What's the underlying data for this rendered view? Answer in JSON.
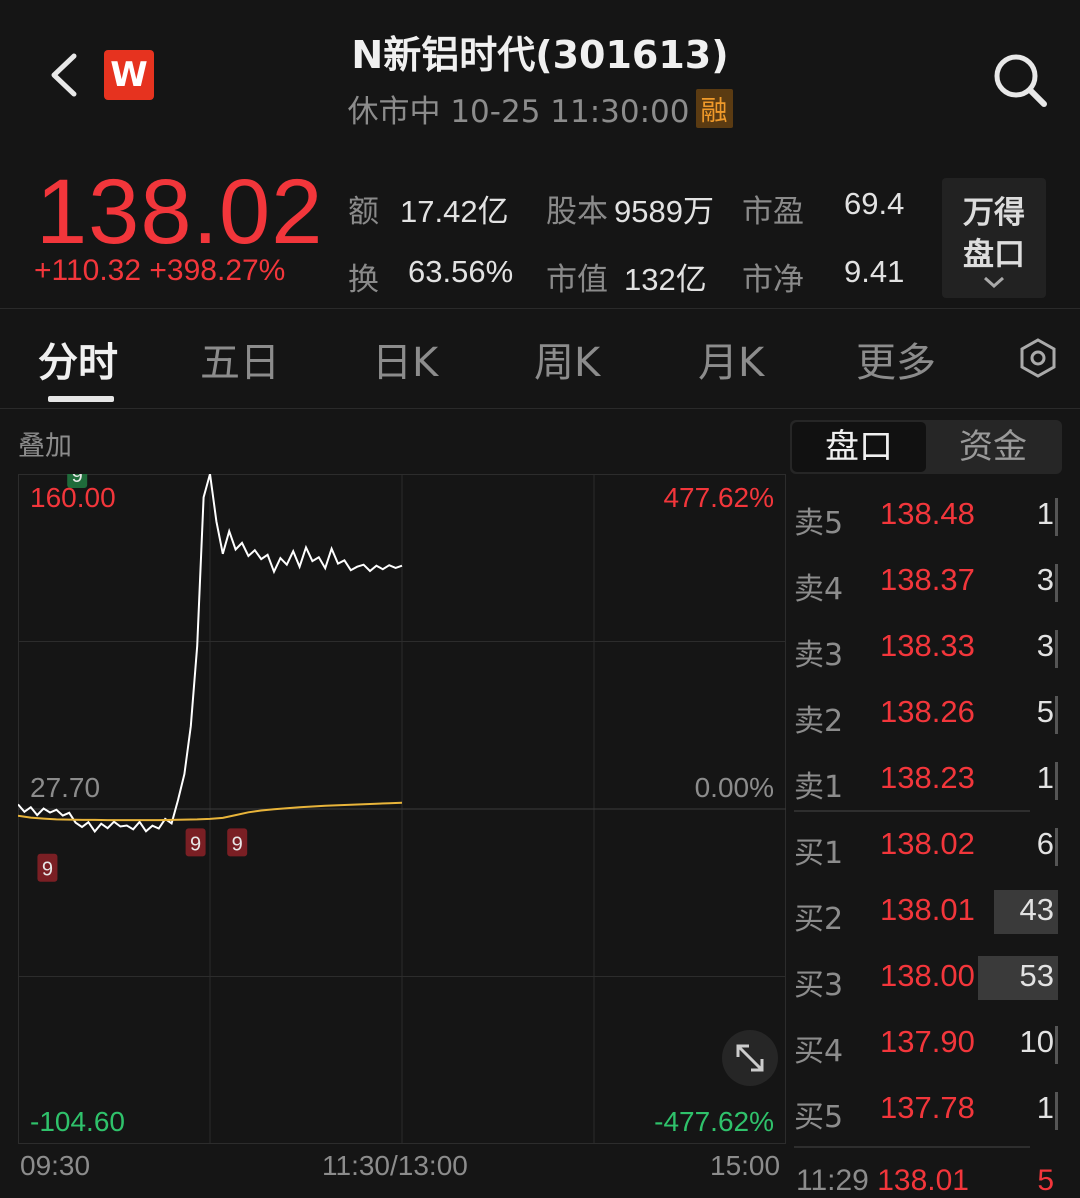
{
  "header": {
    "title": "N新铝时代(301613)",
    "status": "休市中 10-25 11:30:00",
    "margin_badge": "融",
    "logo_letter": "W"
  },
  "quote": {
    "price": "138.02",
    "change": "+110.32",
    "change_pct": "+398.27%",
    "stats": [
      {
        "label": "额",
        "value": "17.42亿"
      },
      {
        "label": "股本",
        "value": "9589万"
      },
      {
        "label": "市盈",
        "value": "69.4"
      },
      {
        "label": "换",
        "value": "63.56%"
      },
      {
        "label": "市值",
        "value": "132亿"
      },
      {
        "label": "市净",
        "value": "9.41"
      }
    ],
    "wind_button": [
      "万得",
      "盘口"
    ]
  },
  "tabs": [
    "分时",
    "五日",
    "日K",
    "周K",
    "月K",
    "更多"
  ],
  "active_tab": "分时",
  "chart": {
    "overlay_label": "叠加",
    "y_left": {
      "top": "160.00",
      "mid": "27.70",
      "bottom": "-104.60"
    },
    "y_right": {
      "top": "477.62%",
      "mid": "0.00%",
      "bottom": "-477.62%"
    },
    "time_labels": [
      "09:30",
      "11:30/13:00",
      "15:00"
    ],
    "marker_label": "9"
  },
  "chart_data": {
    "type": "line",
    "ylim": [
      -104.6,
      160.0
    ],
    "x_range": [
      "09:30",
      "15:00"
    ],
    "series": [
      {
        "values": [
          29.5,
          26.6,
          28.4,
          25.3,
          27.9,
          26.3,
          27.4,
          25.1,
          26.2,
          22.3,
          20.6,
          22.5,
          18.8,
          21.9,
          20.1,
          22.7,
          20.8,
          21.2,
          19.7,
          22.6,
          18.9,
          21.1,
          20.0,
          23.8,
          22.0,
          31.2,
          41.5,
          60.4,
          92.1,
          150.8,
          160.0,
          141.3,
          128.5,
          137.4,
          130.2,
          132.8,
          127.6,
          129.9,
          126.4,
          128.1,
          121.4,
          126.8,
          124.2,
          129.5,
          123.4,
          131.0,
          125.6,
          127.1,
          122.8,
          130.5,
          124.6,
          125.9,
          122.0,
          123.4,
          124.2,
          121.7,
          123.8,
          122.4,
          124.0,
          122.9,
          123.8
        ]
      },
      {
        "values": [
          25.0,
          24.3,
          23.9,
          23.6,
          23.5,
          23.4,
          23.4,
          23.3,
          23.3,
          23.3,
          23.3,
          23.3,
          23.4,
          23.5,
          23.6,
          23.8,
          24.2,
          25.3,
          26.4,
          27.1,
          27.6,
          28.0,
          28.4,
          28.7,
          29.0,
          29.2,
          29.4,
          29.6,
          29.8,
          30.0,
          30.2
        ]
      }
    ]
  },
  "order_book": {
    "tabs": [
      "盘口",
      "资金"
    ],
    "asks": [
      {
        "label": "卖5",
        "price": "138.48",
        "volume": "1"
      },
      {
        "label": "卖4",
        "price": "138.37",
        "volume": "3"
      },
      {
        "label": "卖3",
        "price": "138.33",
        "volume": "3"
      },
      {
        "label": "卖2",
        "price": "138.26",
        "volume": "5"
      },
      {
        "label": "卖1",
        "price": "138.23",
        "volume": "1"
      }
    ],
    "bids": [
      {
        "label": "买1",
        "price": "138.02",
        "volume": "6"
      },
      {
        "label": "买2",
        "price": "138.01",
        "volume": "43"
      },
      {
        "label": "买3",
        "price": "138.00",
        "volume": "53"
      },
      {
        "label": "买4",
        "price": "137.90",
        "volume": "10"
      },
      {
        "label": "买5",
        "price": "137.78",
        "volume": "1"
      }
    ],
    "last_tick": {
      "time": "11:29",
      "price": "138.01",
      "volume": "5"
    }
  },
  "colors": {
    "up": "#f2363b",
    "down": "#2fc26b",
    "price_line": "#ffffff",
    "avg_line": "#e8b43a",
    "background": "#151515"
  }
}
